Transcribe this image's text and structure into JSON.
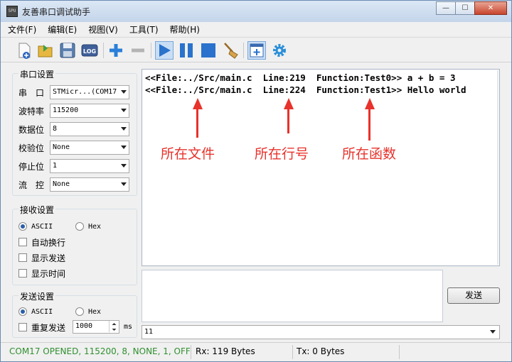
{
  "window": {
    "title": "友善串口调试助手",
    "icon_label": "SPU"
  },
  "menu": [
    "文件(F)",
    "编辑(E)",
    "视图(V)",
    "工具(T)",
    "帮助(H)"
  ],
  "toolbar": {
    "log_label": "LOG",
    "icons": [
      "new-file-icon",
      "open-folder-icon",
      "save-icon",
      "log-icon",
      "add-icon",
      "remove-icon",
      "play-icon",
      "pause-icon",
      "stop-icon",
      "broom-icon",
      "window-icon",
      "gear-icon"
    ]
  },
  "serial_settings": {
    "title": "串口设置",
    "rows": [
      {
        "label": "串　口",
        "value": "STMicr...(COM17"
      },
      {
        "label": "波特率",
        "value": "115200"
      },
      {
        "label": "数据位",
        "value": "8"
      },
      {
        "label": "校验位",
        "value": "None"
      },
      {
        "label": "停止位",
        "value": "1"
      },
      {
        "label": "流　控",
        "value": "None"
      }
    ]
  },
  "receive_settings": {
    "title": "接收设置",
    "ascii": "ASCII",
    "hex": "Hex",
    "auto_wrap": "自动换行",
    "show_send": "显示发送",
    "show_time": "显示时间"
  },
  "send_settings": {
    "title": "发送设置",
    "ascii": "ASCII",
    "hex": "Hex",
    "repeat": "重复发送",
    "interval": "1000",
    "unit": "ms"
  },
  "receive": {
    "lines": [
      "<<File:../Src/main.c  Line:219  Function:Test0>> a + b = 3",
      "<<File:../Src/main.c  Line:224  Function:Test1>> Hello world"
    ],
    "annotations": [
      "所在文件",
      "所在行号",
      "所在函数"
    ]
  },
  "send": {
    "button": "发送",
    "history_value": "11"
  },
  "status": {
    "port": "COM17 OPENED, 115200, 8, NONE, 1, OFF",
    "rx": "Rx: 119 Bytes",
    "tx": "Tx: 0 Bytes"
  },
  "colors": {
    "annotation": "#e8322b",
    "status_port": "#2f8f2f",
    "accent": "#2a7fd8"
  }
}
